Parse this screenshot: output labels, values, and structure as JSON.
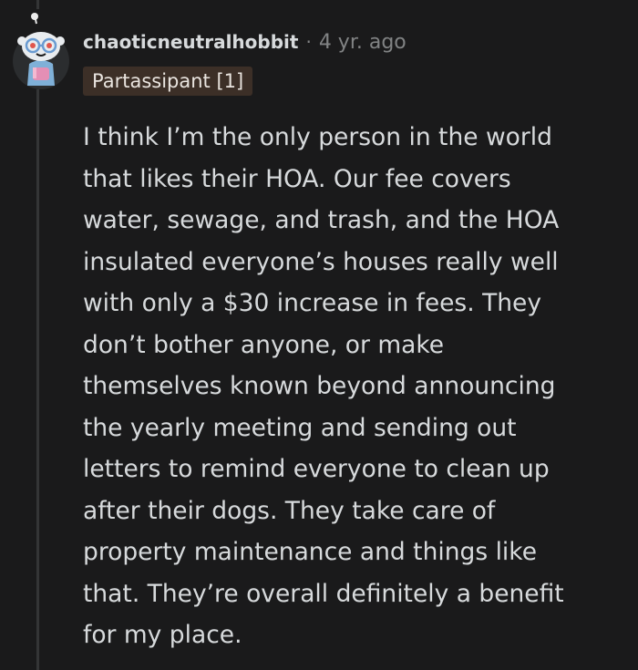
{
  "comment": {
    "username": "chaoticneutralhobbit",
    "separator": "·",
    "timestamp": "4 yr. ago",
    "flair": "Partassipant [1]",
    "avatar_icon": "snoo-avatar-icon",
    "body_lines": [
      "I think I’m the only person in the world",
      "that likes their HOA. Our fee covers",
      "water, sewage, and trash, and the HOA",
      "insulated everyone’s houses really well",
      "with only a $30 increase in fees. They",
      "don’t bother anyone, or make",
      "themselves known beyond announcing",
      "the yearly meeting and sending out",
      "letters to remind everyone to clean up",
      "after their dogs. They take care of",
      "property maintenance and things like",
      "that. They’re overall definitely a benefit",
      "for my place."
    ]
  },
  "colors": {
    "background": "#1a1a1b",
    "text": "#d7dadc",
    "meta": "#818384",
    "flair_bg": "#3c2f27",
    "thread_line": "#343536"
  }
}
